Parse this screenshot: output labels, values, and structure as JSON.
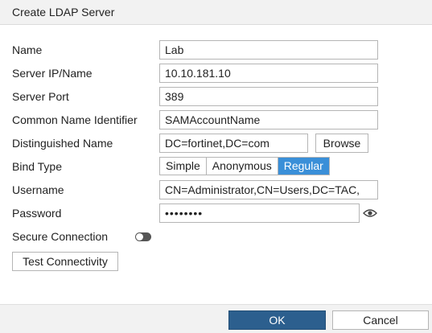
{
  "dialog": {
    "title": "Create LDAP Server"
  },
  "form": {
    "name": {
      "label": "Name",
      "value": "Lab"
    },
    "server": {
      "label": "Server IP/Name",
      "value": "10.10.181.10"
    },
    "port": {
      "label": "Server Port",
      "value": "389"
    },
    "cn_identifier": {
      "label": "Common Name Identifier",
      "value": "SAMAccountName"
    },
    "dn": {
      "label": "Distinguished Name",
      "value": "DC=fortinet,DC=com",
      "browse_label": "Browse"
    },
    "bind_type": {
      "label": "Bind Type",
      "options": [
        "Simple",
        "Anonymous",
        "Regular"
      ],
      "selected": "Regular"
    },
    "username": {
      "label": "Username",
      "value": "CN=Administrator,CN=Users,DC=TAC,"
    },
    "password": {
      "label": "Password",
      "value": "••••••••"
    },
    "secure": {
      "label": "Secure Connection",
      "enabled": false
    },
    "test_label": "Test Connectivity"
  },
  "footer": {
    "ok_label": "OK",
    "cancel_label": "Cancel"
  },
  "colors": {
    "accent": "#3a8fd8",
    "ok": "#2c5f8e"
  }
}
